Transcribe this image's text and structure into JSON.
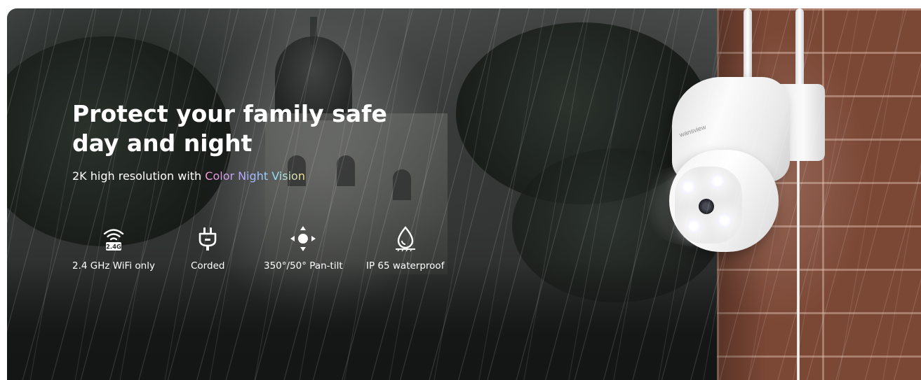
{
  "hero": {
    "headline_line1": "Protect your family safe",
    "headline_line2": "day and night",
    "subheadline_prefix": "2K high resolution with",
    "subheadline_highlight": "Color Night Vision"
  },
  "features": [
    {
      "label": "2.4 GHz WiFi only",
      "icon": "wifi-2.4g-icon",
      "badge": "2.4G"
    },
    {
      "label": "Corded",
      "icon": "power-plug-icon"
    },
    {
      "label": "350°/50° Pan-tilt",
      "icon": "pan-tilt-arrows-icon"
    },
    {
      "label": "IP 65 waterproof",
      "icon": "waterproof-drop-icon"
    }
  ],
  "camera": {
    "brand": "wansview"
  },
  "colors": {
    "text": "#ffffff",
    "highlight_gradient": [
      "#ff9ad4",
      "#b8a4ff",
      "#8fe0ff",
      "#ffe58a"
    ],
    "wall": "#7c4836"
  }
}
